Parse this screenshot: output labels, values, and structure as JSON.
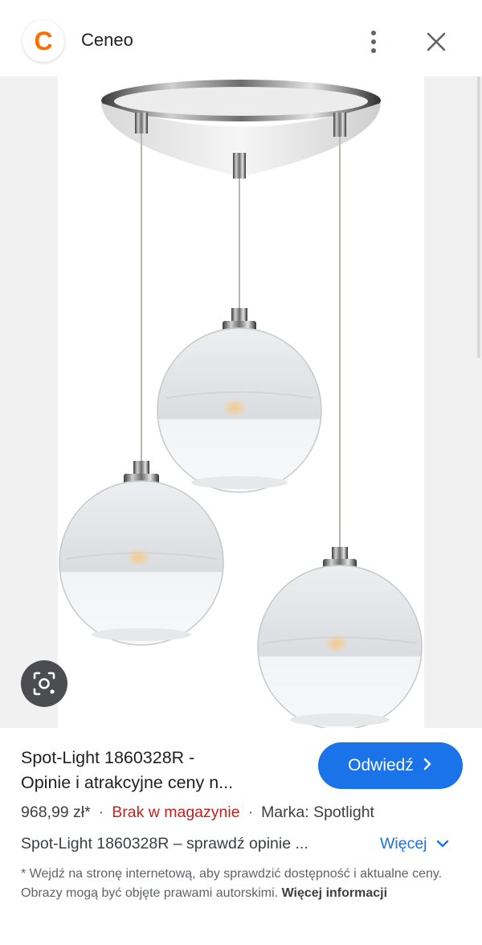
{
  "header": {
    "site_name": "Ceneo",
    "logo_letter": "C",
    "logo_color": "#ff6c00",
    "menu_icon": "more-vert-icon",
    "close_icon": "close-icon"
  },
  "image": {
    "lens_icon": "lens-search-icon"
  },
  "result": {
    "title_line1": "Spot-Light 1860328R -",
    "title_line2": "Opinie i atrakcyjne ceny n...",
    "visit_label": "Odwiedź",
    "price": "968,99 zł*",
    "separator": "·",
    "stock": "Brak w magazynie",
    "brand": "Marka: Spotlight",
    "description": "Spot-Light 1860328R – sprawdź opinie ...",
    "more_label": "Więcej",
    "disclaimer_text": "* Wejdź na stronę internetową, aby sprawdzić dostępność i aktualne ceny. Obrazy mogą być objęte prawami autorskimi.",
    "disclaimer_link": "Więcej informacji"
  },
  "colors": {
    "accent": "#1a73e8",
    "stock_red": "#c5221f"
  }
}
